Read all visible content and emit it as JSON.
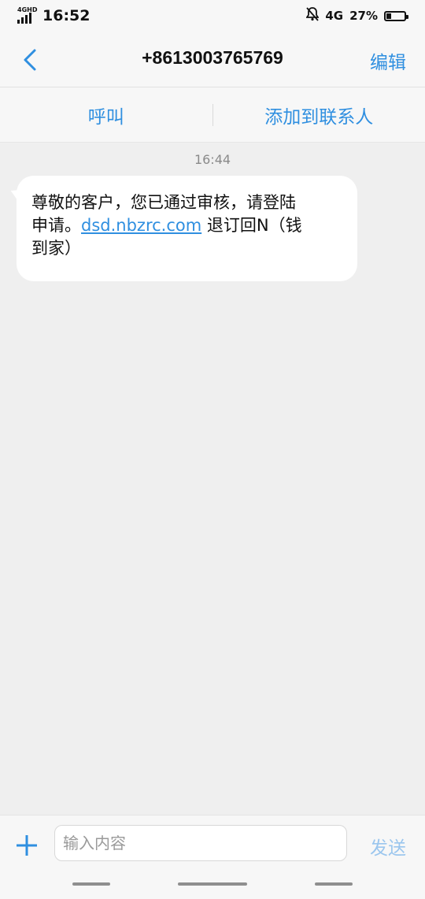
{
  "status_bar": {
    "network_label": "4GHD",
    "time": "16:52",
    "network_type": "4G",
    "battery_percent": "27%",
    "battery_level": 0.27
  },
  "header": {
    "title": "+8613003765769",
    "edit_label": "编辑"
  },
  "actions": {
    "call_label": "呼叫",
    "add_contact_label": "添加到联系人"
  },
  "conversation": {
    "timestamp": "16:44",
    "message": {
      "line1": "尊敬的客户，您已通过审核，请登陆",
      "line2_prefix": "申请。",
      "link_text": "dsd.nbzrc.com",
      "line2_suffix": " 退订回N（钱",
      "line3": "到家）"
    }
  },
  "composer": {
    "input_placeholder": "输入内容",
    "input_value": "",
    "send_label": "发送"
  },
  "colors": {
    "accent": "#2f8fe0",
    "send_disabled": "#9bc6ee",
    "background": "#efefef"
  }
}
